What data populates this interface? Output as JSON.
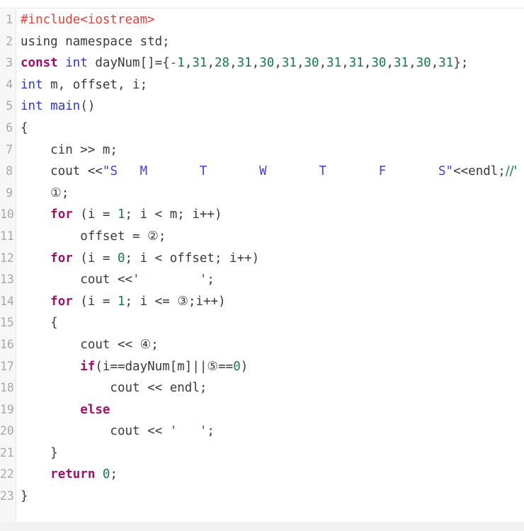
{
  "editor": {
    "language": "C++",
    "line_count": 23,
    "gutter_first": "1",
    "gutter_last": "23",
    "colors": {
      "background": "#ffffff",
      "gutter_background": "#f7f7f7",
      "gutter_text": "#a8a8a8",
      "plain_text": "#3a3a3a",
      "preprocessor": "#e8413a",
      "keyword": "#a0106a",
      "type": "#2b35d0",
      "number": "#17794f",
      "string": "#4040de",
      "comment": "#17794f",
      "footer_band": "#f2f2f2"
    }
  },
  "line_numbers": [
    "1",
    "2",
    "3",
    "4",
    "5",
    "6",
    "7",
    "8",
    "9",
    "10",
    "11",
    "12",
    "13",
    "14",
    "15",
    "16",
    "17",
    "18",
    "19",
    "20",
    "21",
    "22",
    "23"
  ],
  "code": {
    "raw_lines": [
      "#include<iostream>",
      "using namespace std;",
      "const int dayNum[]={-1,31,28,31,30,31,30,31,31,30,31,30,31};",
      "int m, offset, i;",
      "int main()",
      "{",
      "    cin >> m;",
      "    cout <<\"S\\tM\\tT\\tW\\tT\\tF\\tS\"<<endl;//'\\t'为tab制表符",
      "    ①;",
      "    for (i = 1; i < m; i++)",
      "        offset = ②;",
      "    for (i = 0; i < offset; i++)",
      "        cout <<'\\t';",
      "    for (i = 1; i <= ③;i++)",
      "    {",
      "        cout << ④;",
      "        if(i==dayNum[m]||⑤==0)",
      "            cout << endl;",
      "        else",
      "            cout << '\\t';",
      "    }",
      "    return 0;",
      "}"
    ],
    "line_1": {
      "preprocessor": "#include<iostream>"
    },
    "line_2": {
      "plain": "using namespace std;"
    },
    "line_3": {
      "kw": "const",
      "type": "int",
      "name": " dayNum[]={",
      "numbers": [
        "-1",
        "31",
        "28",
        "31",
        "30",
        "31",
        "30",
        "31",
        "31",
        "30",
        "31",
        "30",
        "31"
      ],
      "tail": "};"
    },
    "line_4": {
      "type": "int",
      "plain": " m, offset, i;"
    },
    "line_5": {
      "type1": "int",
      "type2": "main",
      "plain": "()"
    },
    "line_6": {
      "plain": "{"
    },
    "line_7": {
      "plain": "    cin >> m;"
    },
    "line_8": {
      "plain_pre": "    cout <<",
      "string": "\"S\tM\tT\tW\tT\tF\tS\"",
      "plain_mid": "<<endl;",
      "comment": "//'\t'为tab制表符"
    },
    "line_9": {
      "blank_marker": "①",
      "plain": ";"
    },
    "line_10": {
      "kw": "for",
      "pre": " (i = ",
      "n1": "1",
      "mid": "; i < m; i++)"
    },
    "line_11": {
      "pre": "        offset = ",
      "blank_marker": "②",
      "tail": ";"
    },
    "line_12": {
      "kw": "for",
      "pre": " (i = ",
      "n1": "0",
      "mid": "; i < offset; i++)"
    },
    "line_13": {
      "pre": "        cout <<",
      "char_literal": "'\t'",
      "tail": ";"
    },
    "line_14": {
      "kw": "for",
      "pre": " (i = ",
      "n1": "1",
      "mid": "; i <= ",
      "blank_marker": "③",
      "tail": ";i++)"
    },
    "line_15": {
      "plain": "    {"
    },
    "line_16": {
      "pre": "        cout << ",
      "blank_marker": "④",
      "tail": ";"
    },
    "line_17": {
      "kw": "if",
      "pre": "(i==dayNum[m]||",
      "blank_marker": "⑤",
      "mid": "==",
      "n1": "0",
      "tail": ")"
    },
    "line_18": {
      "plain": "            cout << endl;"
    },
    "line_19": {
      "kw": "else"
    },
    "line_20": {
      "pre": "            cout << ",
      "char_literal": "'\t'",
      "tail": ";"
    },
    "line_21": {
      "plain": "    }"
    },
    "line_22": {
      "kw": "return",
      "sp": " ",
      "n1": "0",
      "tail": ";"
    },
    "line_23": {
      "plain": "}"
    }
  },
  "blanks": {
    "markers": [
      "①",
      "②",
      "③",
      "④",
      "⑤"
    ],
    "count": 5
  }
}
